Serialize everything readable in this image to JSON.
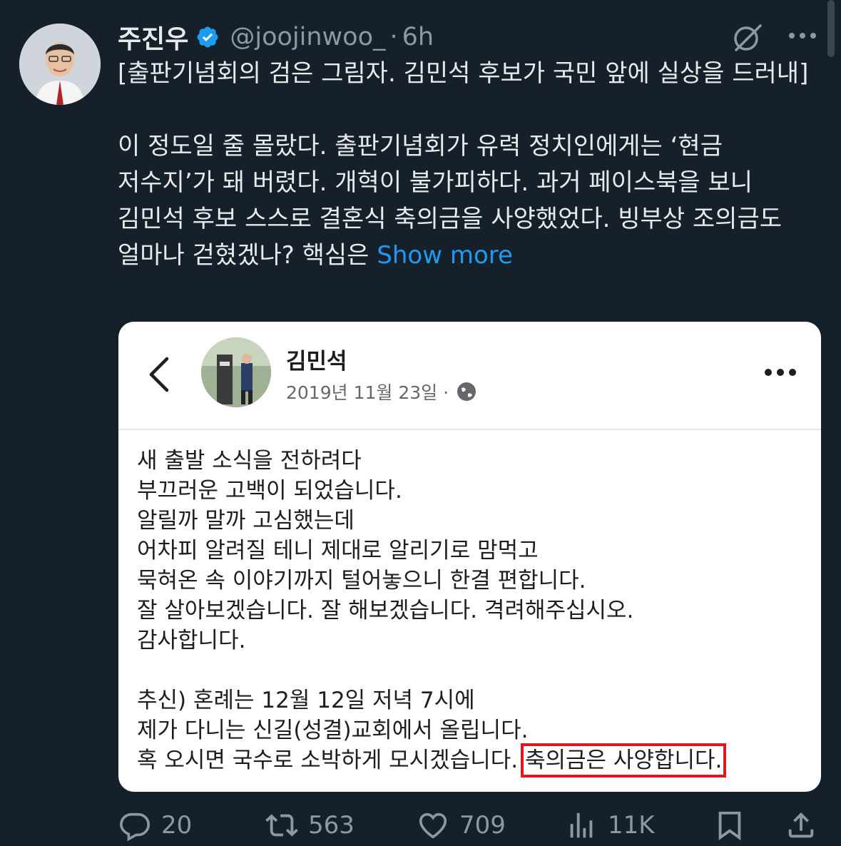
{
  "tweet": {
    "author_name": "주진우",
    "handle": "@joojinwoo_",
    "separator": "·",
    "time": "6h",
    "text": "[출판기념회의 검은 그림자. 김민석 후보가 국민 앞에 실상을 드러내]\n\n이 정도일 줄 몰랐다. 출판기념회가 유력 정치인에게는 ‘현금 저수지’가 돼 버렸다. 개혁이 불가피하다. 과거 페이스북을 보니 김민석 후보 스스로 결혼식 축의금을 사양했었다. 빙부상 조의금도 얼마나 걷혔겠나? 핵심은 ",
    "show_more": "Show more"
  },
  "embedded_post": {
    "author_name": "김민석",
    "date": "2019년 11월 23일 ·",
    "body_main": "새 출발 소식을 전하려다\n부끄러운 고백이 되었습니다.\n알릴까 말까 고심했는데\n어차피 알려질 테니 제대로 알리기로 맘먹고\n묵혀온 속 이야기까지 털어놓으니 한결 편합니다.\n잘 살아보겠습니다. 잘 해보겠습니다. 격려해주십시오.\n감사합니다.\n\n추신) 혼례는 12월 12일 저녁 7시에\n제가 다니는 신길(성결)교회에서 올립니다.\n혹 오시면 국수로 소박하게 모시겠습니다. ",
    "body_highlight": "축의금은 사양합니다."
  },
  "actions": {
    "replies": "20",
    "retweets": "563",
    "likes": "709",
    "views": "11K"
  },
  "colors": {
    "background": "#15202b",
    "accent": "#1d9bf0",
    "highlight_box": "#e0171f"
  }
}
